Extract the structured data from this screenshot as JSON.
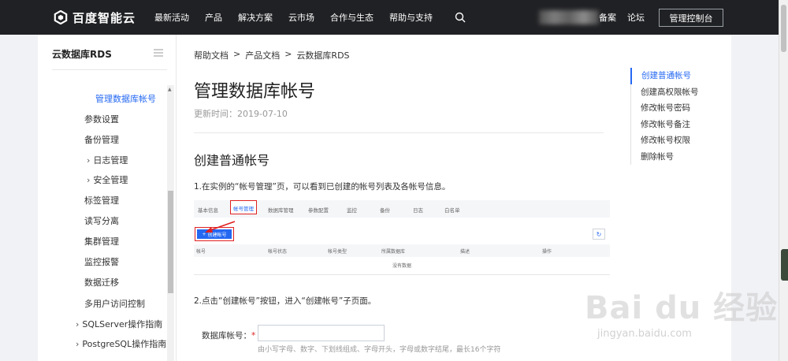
{
  "topnav": {
    "brand": "百度智能云",
    "items": [
      "最新活动",
      "产品",
      "解决方案",
      "云市场",
      "合作与生态",
      "帮助与支持"
    ],
    "right_items": [
      "备案",
      "论坛"
    ],
    "console_button": "管理控制台"
  },
  "sidebar": {
    "title": "云数据库RDS",
    "items": [
      {
        "label": "管理数据库帐号",
        "active": true
      },
      {
        "label": "参数设置"
      },
      {
        "label": "备份管理"
      },
      {
        "label": "日志管理",
        "expandable": true
      },
      {
        "label": "安全管理",
        "expandable": true
      },
      {
        "label": "标签管理"
      },
      {
        "label": "读写分离"
      },
      {
        "label": "集群管理"
      },
      {
        "label": "监控报警"
      },
      {
        "label": "数据迁移"
      },
      {
        "label": "多用户访问控制"
      },
      {
        "label": "SQLServer操作指南",
        "expandable": true
      },
      {
        "label": "PostgreSQL操作指南",
        "expandable": true
      }
    ]
  },
  "breadcrumb": [
    "帮助文档",
    "产品文档",
    "云数据库RDS"
  ],
  "breadcrumb_sep": ">",
  "page": {
    "title": "管理数据库帐号",
    "update_time": "更新时间：2019-07-10",
    "section_title": "创建普通帐号",
    "step1": "1.在实例的“帐号管理”页，可以看到已创建的帐号列表及各帐号信息。",
    "step2": "2.点击“创建帐号”按钮，进入“创建帐号”子页面。"
  },
  "embedded_shot": {
    "tabs": [
      "基本信息",
      "帐号管理",
      "数据库管理",
      "参数配置",
      "监控",
      "备份",
      "日志",
      "白名单"
    ],
    "active_tab": "帐号管理",
    "create_button": "创建帐号",
    "columns": [
      "帐号",
      "帐号状态",
      "帐号类型",
      "所属数据库",
      "描述",
      "操作"
    ],
    "empty_text": "没有数据"
  },
  "form": {
    "label": "数据库帐号：",
    "required_mark": "*",
    "value": "",
    "placeholder": "",
    "hint": "由小写字母、数字、下划线组成、字母开头，字母或数字结尾，最长16个字符"
  },
  "toc": {
    "items": [
      "创建普通帐号",
      "创建高权限帐号",
      "修改帐号密码",
      "修改帐号备注",
      "修改帐号权限",
      "删除帐号"
    ],
    "active_index": 0
  },
  "watermark": {
    "text": "Bai du 经验",
    "url": "jingyan.baidu.com"
  },
  "colors": {
    "topbar": "#202124",
    "accent": "#2468f2",
    "highlight": "#e02020"
  }
}
